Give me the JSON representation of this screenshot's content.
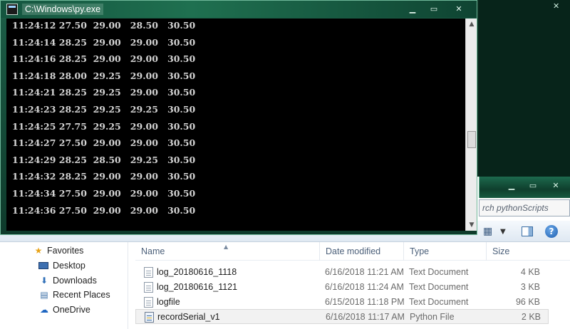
{
  "console": {
    "title": "C:\\Windows\\py.exe",
    "lines": [
      "11:24:12 27.50  29.00   28.50   30.50",
      "11:24:14 28.25  29.00   29.00   30.50",
      "11:24:16 28.25  29.00   29.00   30.50",
      "11:24:18 28.00  29.25   29.00   30.50",
      "11:24:21 28.25  29.25   29.00   30.50",
      "11:24:23 28.25  29.25   29.25   30.50",
      "11:24:25 27.75  29.25   29.00   30.50",
      "11:24:27 27.50  29.00   29.00   30.50",
      "11:24:29 28.25  28.50   29.25   30.50",
      "11:24:32 28.25  29.00   29.00   30.50",
      "11:24:34 27.50  29.00   29.00   30.50",
      "11:24:36 27.50  29.00   29.00   30.50"
    ]
  },
  "explorer": {
    "search_placeholder": "rch pythonScripts",
    "nav": {
      "favorites": "Favorites",
      "items": [
        {
          "label": "Desktop",
          "icon": "desktop-icon"
        },
        {
          "label": "Downloads",
          "icon": "downloads-icon"
        },
        {
          "label": "Recent Places",
          "icon": "recent-places-icon"
        },
        {
          "label": "OneDrive",
          "icon": "onedrive-icon"
        }
      ]
    },
    "columns": {
      "name": "Name",
      "date": "Date modified",
      "type": "Type",
      "size": "Size"
    },
    "files": [
      {
        "name": "log_20180616_1118",
        "date": "6/16/2018 11:21 AM",
        "type": "Text Document",
        "size": "4 KB"
      },
      {
        "name": "log_20180616_1121",
        "date": "6/16/2018 11:24 AM",
        "type": "Text Document",
        "size": "3 KB"
      },
      {
        "name": "logfile",
        "date": "6/15/2018 11:18 PM",
        "type": "Text Document",
        "size": "96 KB"
      },
      {
        "name": "recordSerial_v1",
        "date": "6/16/2018 11:17 AM",
        "type": "Python File",
        "size": "2 KB"
      }
    ]
  },
  "colors": {
    "console_bg": "#000000",
    "console_text": "#d4d4d4",
    "window_frame": "#1c5e47",
    "favorites_star": "#e8a317"
  }
}
